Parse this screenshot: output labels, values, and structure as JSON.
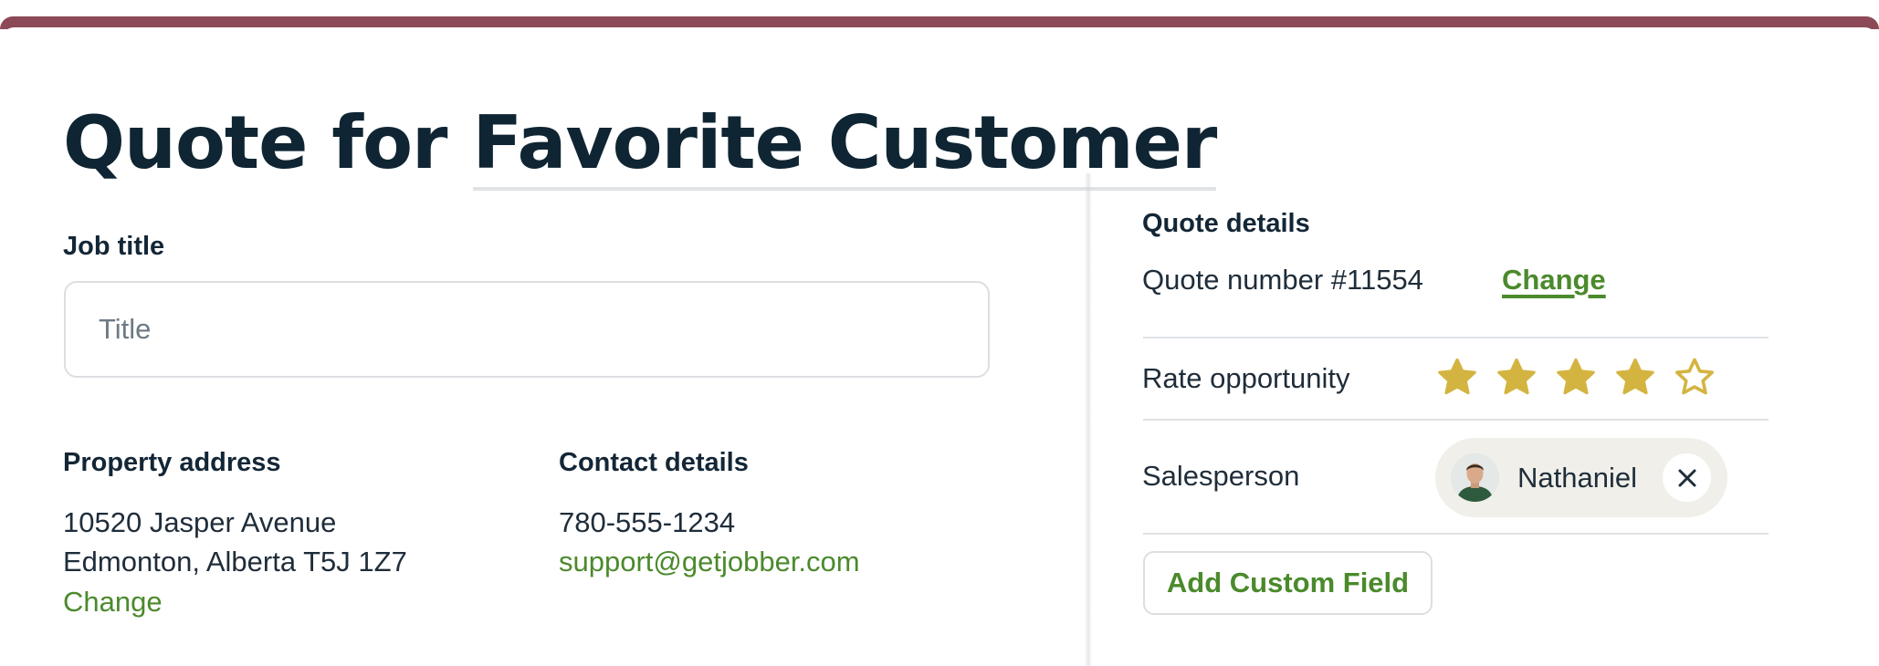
{
  "heading": {
    "prefix": "Quote for",
    "customer_name": "Favorite Customer"
  },
  "job": {
    "label": "Job title",
    "placeholder": "Title",
    "value": ""
  },
  "property": {
    "label": "Property address",
    "line1": "10520 Jasper Avenue",
    "line2": "Edmonton, Alberta T5J 1Z7",
    "change_label": "Change"
  },
  "contact": {
    "label": "Contact details",
    "phone": "780-555-1234",
    "email": "support@getjobber.com"
  },
  "quote_details": {
    "title": "Quote details",
    "quote_number_text": "Quote number #11554",
    "change_label": "Change",
    "rate_label": "Rate opportunity",
    "rating": 4,
    "rating_max": 5,
    "salesperson_label": "Salesperson",
    "salesperson_name": "Nathaniel",
    "add_custom_field_label": "Add Custom Field"
  },
  "colors": {
    "accent_bar": "#8c4a56",
    "link_green": "#4b8a2c",
    "star_gold": "#d4b441",
    "chip_bg": "#f0efe9"
  },
  "icons": {
    "star_filled": "star-filled-icon",
    "star_empty": "star-outline-icon",
    "close": "close-icon",
    "avatar": "avatar"
  }
}
